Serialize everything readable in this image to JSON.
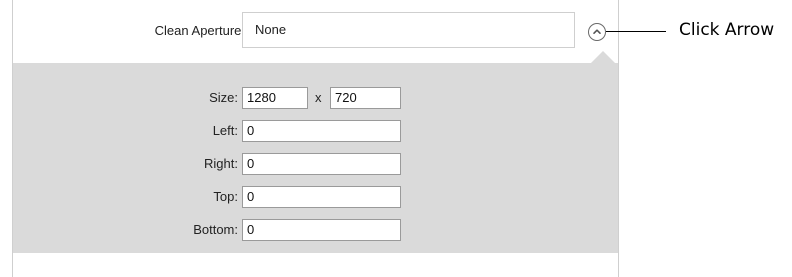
{
  "clean_aperture": {
    "label": "Clean Aperture:",
    "value": "None"
  },
  "fields": {
    "size_label": "Size:",
    "size_width": "1280",
    "size_separator": "x",
    "size_height": "720",
    "left_label": "Left:",
    "left_value": "0",
    "right_label": "Right:",
    "right_value": "0",
    "top_label": "Top:",
    "top_value": "0",
    "bottom_label": "Bottom:",
    "bottom_value": "0"
  },
  "callout": {
    "text": "Click Arrow"
  },
  "icons": {
    "expand": "chevron-up-circle-icon"
  }
}
